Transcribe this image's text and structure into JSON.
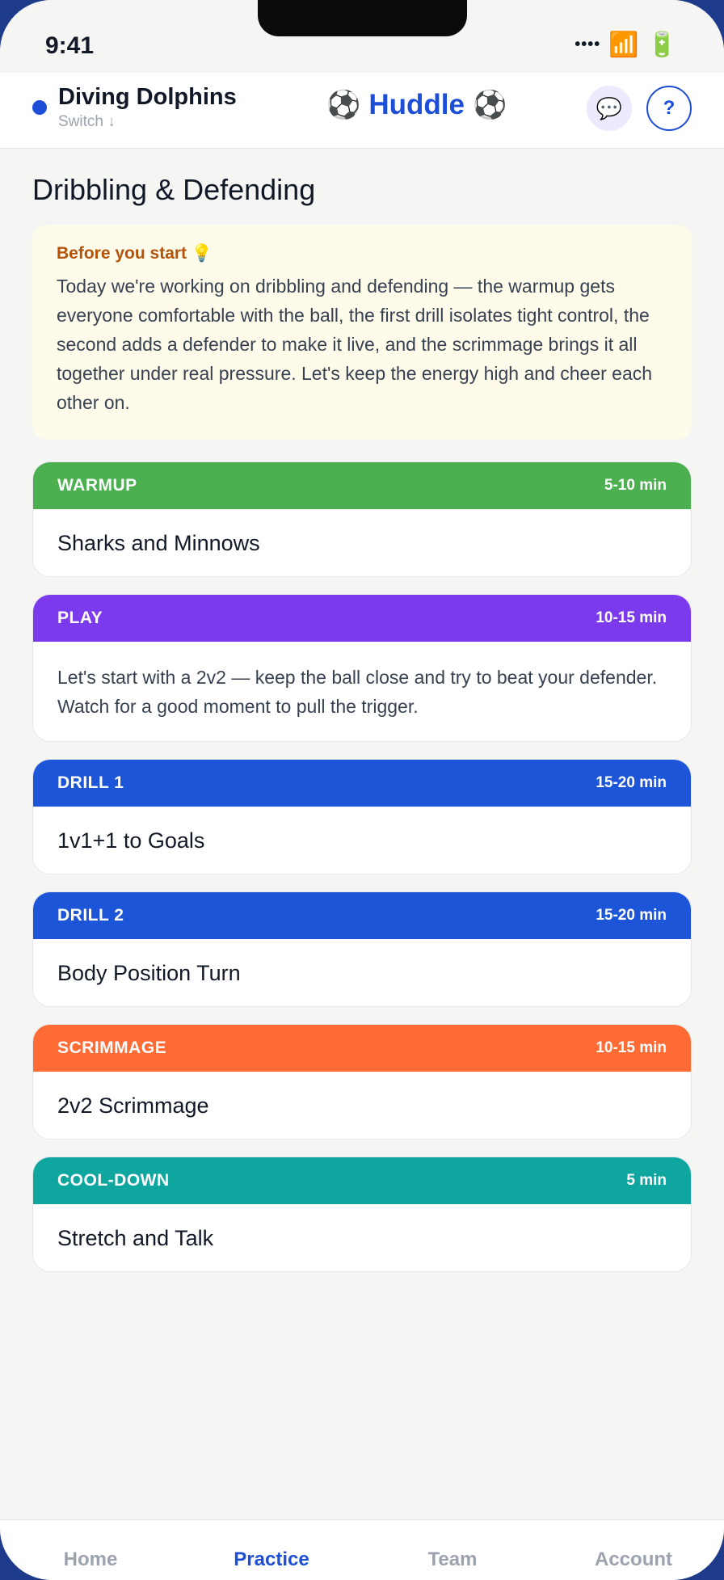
{
  "status_bar": {
    "time": "9:41",
    "signal": "••••",
    "wifi_icon": "📶",
    "battery_icon": "🔋"
  },
  "header": {
    "team_name": "Diving Dolphins",
    "switch_label": "Switch ↓",
    "brand_name": "Huddle",
    "brand_icon": "⚽",
    "chat_icon": "💬",
    "help_label": "?"
  },
  "page_title": "Dribbling & Defending",
  "intro": {
    "title": "Before you start 💡",
    "body": "Today we're working on dribbling and defending — the warmup gets everyone comfortable with the ball, the first drill isolates tight control, the second adds a defender to make it live, and the scrimmage brings it all together under real pressure. Let's keep the energy high and cheer each other on."
  },
  "blocks": [
    {
      "label": "WARMUP",
      "duration": "5-10 min",
      "title": "Sharks and Minnows",
      "color": "#4caf50"
    },
    {
      "label": "PLAY",
      "duration": "10-15 min",
      "text": "Let's start with a 2v2 — keep the ball close and try to beat your defender. Watch for a good moment to pull the trigger.",
      "color": "#7c3aed"
    },
    {
      "label": "DRILL 1",
      "duration": "15-20 min",
      "title": "1v1+1 to Goals",
      "color": "#1d55d9"
    },
    {
      "label": "DRILL 2",
      "duration": "15-20 min",
      "title": "Body Position Turn",
      "color": "#1d55d9"
    },
    {
      "label": "SCRIMMAGE",
      "duration": "10-15 min",
      "title": "2v2 Scrimmage",
      "color": "#ff6b35"
    },
    {
      "label": "COOL-DOWN",
      "duration": "5 min",
      "title": "Stretch and Talk",
      "color": "#0fa6a0"
    }
  ],
  "tabs": [
    {
      "label": "Home",
      "active": false
    },
    {
      "label": "Practice",
      "active": true
    },
    {
      "label": "Team",
      "active": false
    },
    {
      "label": "Account",
      "active": false
    }
  ],
  "colors": {
    "accent": "#1d4ed8",
    "intro_bg": "#fefbea",
    "intro_title": "#b45309"
  }
}
